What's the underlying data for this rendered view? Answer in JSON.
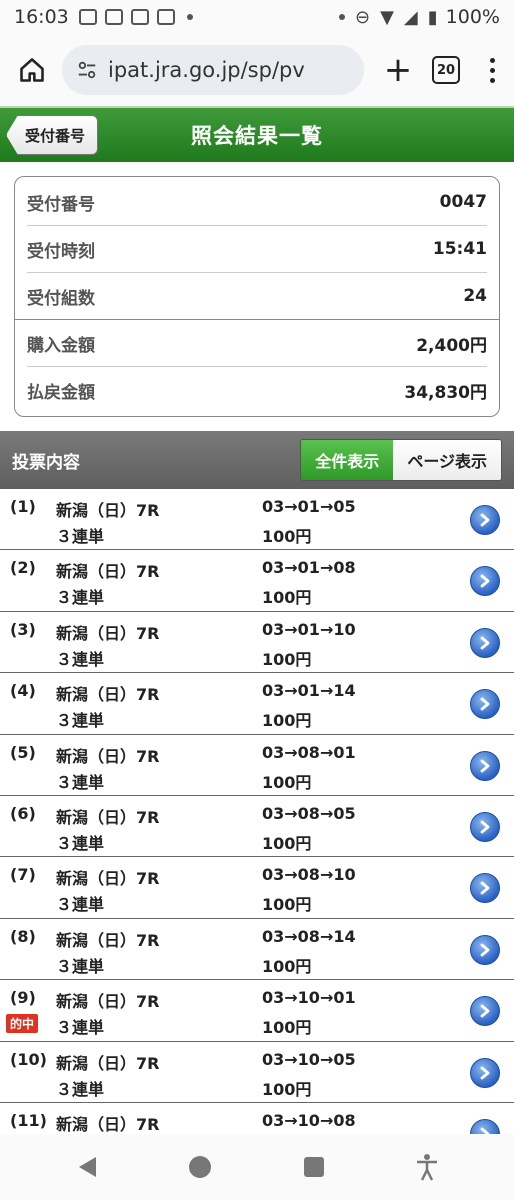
{
  "statusbar": {
    "time": "16:03",
    "battery": "100%"
  },
  "browser": {
    "url": "ipat.jra.go.jp/sp/pv",
    "tab_count": "20"
  },
  "header": {
    "back_label": "受付番号",
    "title": "照会結果一覧"
  },
  "summary": [
    {
      "label": "受付番号",
      "value": "0047"
    },
    {
      "label": "受付時刻",
      "value": "15:41"
    },
    {
      "label": "受付組数",
      "value": "24"
    },
    {
      "label": "購入金額",
      "value": "2,400円"
    },
    {
      "label": "払戻金額",
      "value": "34,830円"
    }
  ],
  "content": {
    "title": "投票内容",
    "toggle_all": "全件表示",
    "toggle_page": "ページ表示"
  },
  "bets": [
    {
      "num": "(1)",
      "venue": "新潟（日）7R",
      "type": "３連単",
      "combo": "03→01→05",
      "amount": "100円",
      "hit": ""
    },
    {
      "num": "(2)",
      "venue": "新潟（日）7R",
      "type": "３連単",
      "combo": "03→01→08",
      "amount": "100円",
      "hit": ""
    },
    {
      "num": "(3)",
      "venue": "新潟（日）7R",
      "type": "３連単",
      "combo": "03→01→10",
      "amount": "100円",
      "hit": ""
    },
    {
      "num": "(4)",
      "venue": "新潟（日）7R",
      "type": "３連単",
      "combo": "03→01→14",
      "amount": "100円",
      "hit": ""
    },
    {
      "num": "(5)",
      "venue": "新潟（日）7R",
      "type": "３連単",
      "combo": "03→08→01",
      "amount": "100円",
      "hit": ""
    },
    {
      "num": "(6)",
      "venue": "新潟（日）7R",
      "type": "３連単",
      "combo": "03→08→05",
      "amount": "100円",
      "hit": ""
    },
    {
      "num": "(7)",
      "venue": "新潟（日）7R",
      "type": "３連単",
      "combo": "03→08→10",
      "amount": "100円",
      "hit": ""
    },
    {
      "num": "(8)",
      "venue": "新潟（日）7R",
      "type": "３連単",
      "combo": "03→08→14",
      "amount": "100円",
      "hit": ""
    },
    {
      "num": "(9)",
      "venue": "新潟（日）7R",
      "type": "３連単",
      "combo": "03→10→01",
      "amount": "100円",
      "hit": "的中"
    },
    {
      "num": "(10)",
      "venue": "新潟（日）7R",
      "type": "３連単",
      "combo": "03→10→05",
      "amount": "100円",
      "hit": ""
    },
    {
      "num": "(11)",
      "venue": "新潟（日）7R",
      "type": "",
      "combo": "03→10→08",
      "amount": "",
      "hit": ""
    }
  ],
  "colors": {
    "header_green": "#2e8a2a",
    "toggle_active": "#3aa630",
    "hit_badge": "#d32",
    "go_button": "#2a62c4"
  }
}
